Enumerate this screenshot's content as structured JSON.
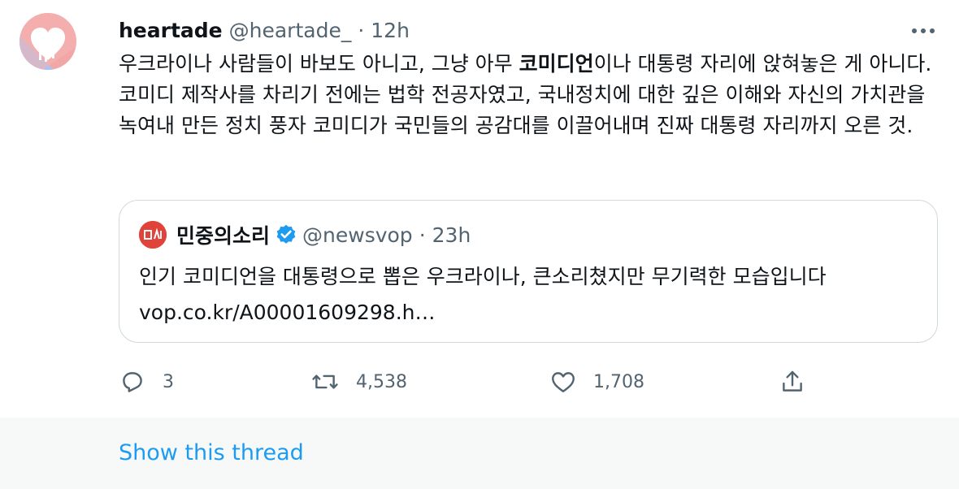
{
  "tweet": {
    "display_name": "heartade",
    "handle": "@heartade_",
    "separator": "·",
    "time": "12h",
    "more_icon": "more-dots-icon",
    "text_before": "우크라이나 사람들이 바보도 아니고, 그냥 아무 ",
    "text_bold": "코미디언",
    "text_after": "이나 대통령 자리에 앉혀놓은 게 아니다. 코미디 제작사를 차리기 전에는 법학 전공자였고, 국내정치에 대한 깊은 이해와 자신의 가치관을 녹여내 만든 정치 풍자 코미디가 국민들의 공감대를 이끌어내며 진짜 대통령 자리까지 오른 것."
  },
  "quote": {
    "display_name": "민중의소리",
    "handle": "@newsvop",
    "separator": "·",
    "time": "23h",
    "avatar_text": "민중의소리 logo",
    "text": "인기 코미디언을 대통령으로 뽑은 우크라이나, 큰소리쳤지만 무기력한 모습입니다",
    "link": "vop.co.kr/A00001609298.h…"
  },
  "actions": {
    "reply_count": "3",
    "retweet_count": "4,538",
    "like_count": "1,708",
    "icons": [
      "reply-icon",
      "retweet-icon",
      "like-icon",
      "share-icon"
    ]
  },
  "footer": {
    "show_thread": "Show this thread"
  },
  "colors": {
    "accent": "#1d9bf0",
    "secondary_text": "#536471",
    "quote_logo": "#e0433a"
  }
}
